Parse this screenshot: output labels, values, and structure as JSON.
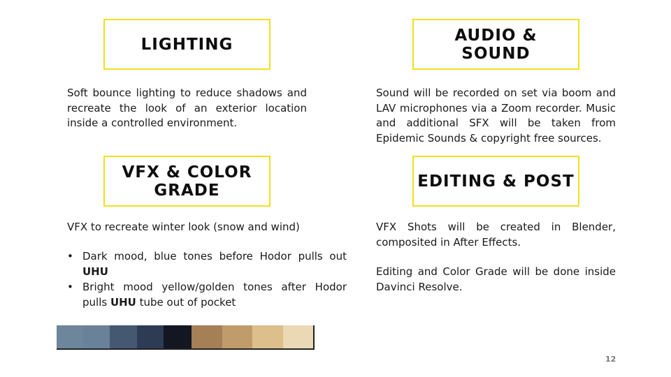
{
  "lighting": {
    "title": "LIGHTING",
    "text": "Soft bounce lighting to reduce shadows and recreate the look of an exterior location inside a controlled environment."
  },
  "audio": {
    "title_line1": "AUDIO &",
    "title_line2": "SOUND",
    "text": "Sound will be recorded on set via boom and LAV microphones via a Zoom recorder. Music and additional SFX will be taken from Epidemic Sounds & copyright free sources."
  },
  "vfx": {
    "title_line1": "VFX & COLOR",
    "title_line2": "GRADE",
    "intro": "VFX to recreate winter look (snow and wind)",
    "bullets": [
      {
        "dot": "•",
        "text_before": "Dark mood, blue tones before Hodor pulls out ",
        "bold": "UHU",
        "text_after": ""
      },
      {
        "dot": "•",
        "text_before": "Bright mood yellow/golden tones after Hodor pulls ",
        "bold": "UHU",
        "text_after": " tube out of pocket"
      }
    ],
    "palette": [
      "#6e869c",
      "#6a8299",
      "#445872",
      "#2e3b55",
      "#121722",
      "#a57f55",
      "#c09c6c",
      "#ddbf8b",
      "#ead9b4"
    ]
  },
  "editing": {
    "title": "EDITING & POST",
    "text1": "VFX Shots will be created in Blender, composited in After Effects.",
    "text2": "Editing and Color Grade will be done inside Davinci Resolve."
  },
  "page_number": "12",
  "colors": {
    "accent_border": "#f2e01c"
  }
}
